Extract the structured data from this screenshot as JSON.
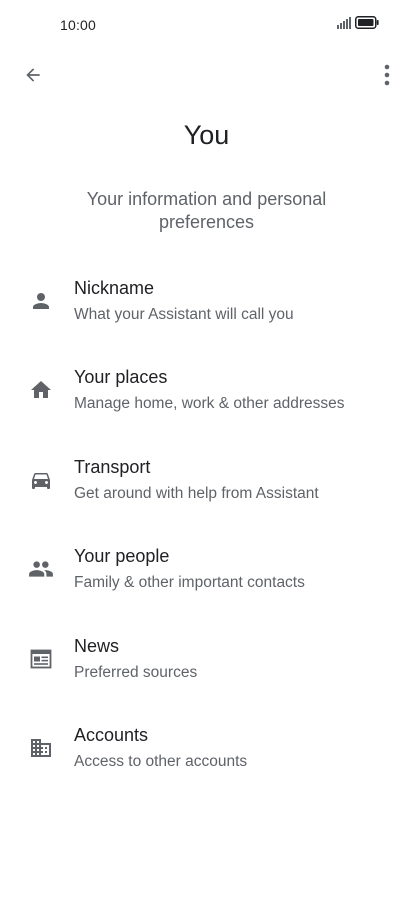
{
  "status_bar": {
    "time": "10:00",
    "icons": [
      "signal-icon",
      "battery-icon"
    ]
  },
  "app_bar": {
    "back_icon": "arrow-back-icon",
    "menu_icon": "more-vert-icon"
  },
  "page": {
    "title": "You",
    "subtitle": "Your information and personal preferences"
  },
  "items": [
    {
      "icon": "person-icon",
      "title": "Nickname",
      "subtitle": "What your Assistant will call you"
    },
    {
      "icon": "home-icon",
      "title": "Your places",
      "subtitle": "Manage home, work & other addresses"
    },
    {
      "icon": "car-icon",
      "title": "Transport",
      "subtitle": "Get around with help from Assistant"
    },
    {
      "icon": "people-icon",
      "title": "Your people",
      "subtitle": "Family & other important contacts"
    },
    {
      "icon": "news-icon",
      "title": "News",
      "subtitle": "Preferred sources"
    },
    {
      "icon": "business-icon",
      "title": "Accounts",
      "subtitle": "Access to other accounts"
    }
  ],
  "colors": {
    "text_primary": "#202124",
    "text_secondary": "#5f6368",
    "icon": "#5f6368"
  }
}
